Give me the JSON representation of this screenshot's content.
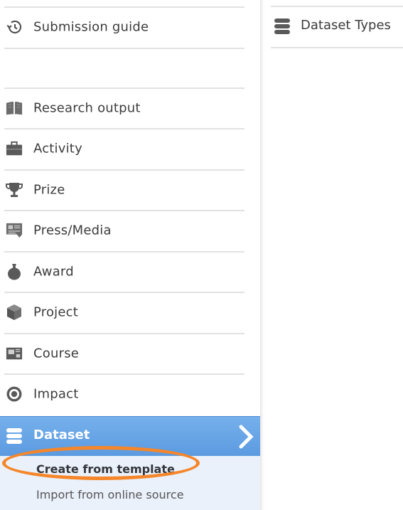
{
  "menu": {
    "top_item": {
      "label": "Submission guide",
      "icon": "history-clock-icon"
    },
    "items": [
      {
        "label": "Research output",
        "icon": "book-icon"
      },
      {
        "label": "Activity",
        "icon": "briefcase-icon"
      },
      {
        "label": "Prize",
        "icon": "trophy-icon"
      },
      {
        "label": "Press/Media",
        "icon": "press-media-icon"
      },
      {
        "label": "Award",
        "icon": "money-bag-icon"
      },
      {
        "label": "Project",
        "icon": "cube-icon"
      },
      {
        "label": "Course",
        "icon": "course-board-icon"
      },
      {
        "label": "Impact",
        "icon": "target-icon"
      }
    ],
    "active": {
      "label": "Dataset",
      "icon": "database-icon"
    },
    "submenu": [
      {
        "label": "Create from template"
      },
      {
        "label": "Import from online source"
      }
    ]
  },
  "right_panel": {
    "item": {
      "label": "Dataset Types",
      "icon": "database-icon"
    }
  },
  "colors": {
    "active_bg": "#5b9ae0",
    "submenu_bg": "#eaf1fb",
    "highlight": "#f5862a"
  }
}
